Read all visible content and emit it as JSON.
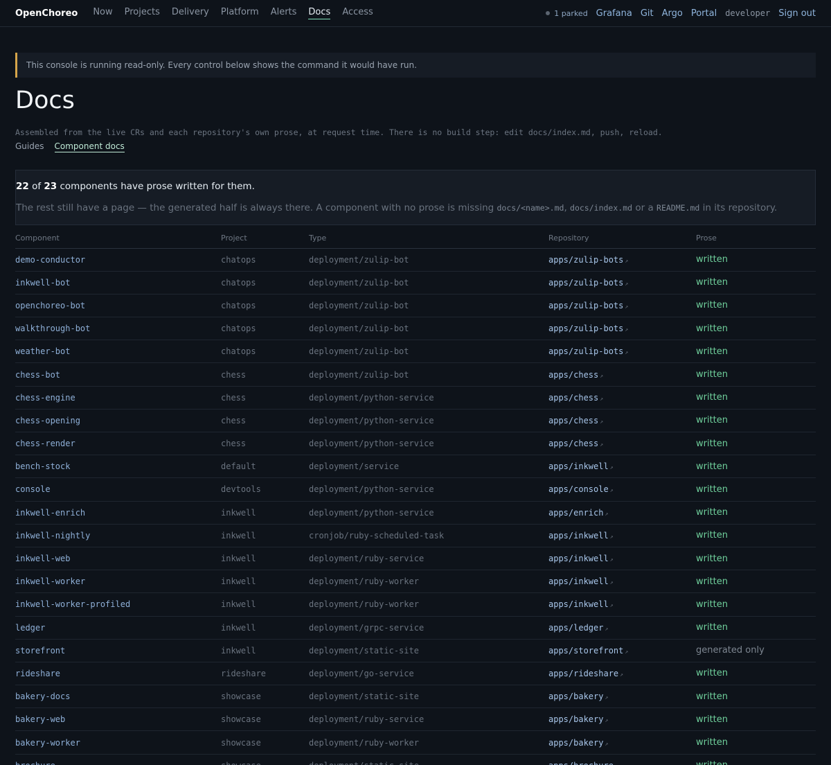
{
  "nav": {
    "brand": "OpenChoreo",
    "links": [
      "Now",
      "Projects",
      "Delivery",
      "Platform",
      "Alerts",
      "Docs",
      "Access"
    ],
    "active": "Docs",
    "parked": "1 parked",
    "right_links": [
      "Grafana",
      "Git",
      "Argo",
      "Portal"
    ],
    "user": "developer",
    "sign_out": "Sign out"
  },
  "banner": "This console is running read-only. Every control below shows the command it would have run.",
  "page": {
    "title": "Docs",
    "subtitle": "Assembled from the live CRs and each repository's own prose, at request time. There is no build step: edit docs/index.md, push, reload.",
    "tabs": [
      "Guides",
      "Component docs"
    ],
    "active_tab": "Component docs"
  },
  "summary": {
    "written_count": "22",
    "of": "of",
    "total_count": "23",
    "line_rest": "components have prose written for them.",
    "note_a": "The rest still have a page — the generated half is always there. A component with no prose is missing ",
    "code1": "docs/<name>.md",
    "sep1": ", ",
    "code2": "docs/index.md",
    "sep2": " or a ",
    "code3": "README.md",
    "note_b": " in its repository."
  },
  "table": {
    "headers": [
      "Component",
      "Project",
      "Type",
      "Repository",
      "Prose"
    ],
    "rows": [
      [
        "demo-conductor",
        "chatops",
        "deployment/zulip-bot",
        "apps/zulip-bots",
        "written"
      ],
      [
        "inkwell-bot",
        "chatops",
        "deployment/zulip-bot",
        "apps/zulip-bots",
        "written"
      ],
      [
        "openchoreo-bot",
        "chatops",
        "deployment/zulip-bot",
        "apps/zulip-bots",
        "written"
      ],
      [
        "walkthrough-bot",
        "chatops",
        "deployment/zulip-bot",
        "apps/zulip-bots",
        "written"
      ],
      [
        "weather-bot",
        "chatops",
        "deployment/zulip-bot",
        "apps/zulip-bots",
        "written"
      ],
      [
        "chess-bot",
        "chess",
        "deployment/zulip-bot",
        "apps/chess",
        "written"
      ],
      [
        "chess-engine",
        "chess",
        "deployment/python-service",
        "apps/chess",
        "written"
      ],
      [
        "chess-opening",
        "chess",
        "deployment/python-service",
        "apps/chess",
        "written"
      ],
      [
        "chess-render",
        "chess",
        "deployment/python-service",
        "apps/chess",
        "written"
      ],
      [
        "bench-stock",
        "default",
        "deployment/service",
        "apps/inkwell",
        "written"
      ],
      [
        "console",
        "devtools",
        "deployment/python-service",
        "apps/console",
        "written"
      ],
      [
        "inkwell-enrich",
        "inkwell",
        "deployment/python-service",
        "apps/enrich",
        "written"
      ],
      [
        "inkwell-nightly",
        "inkwell",
        "cronjob/ruby-scheduled-task",
        "apps/inkwell",
        "written"
      ],
      [
        "inkwell-web",
        "inkwell",
        "deployment/ruby-service",
        "apps/inkwell",
        "written"
      ],
      [
        "inkwell-worker",
        "inkwell",
        "deployment/ruby-worker",
        "apps/inkwell",
        "written"
      ],
      [
        "inkwell-worker-profiled",
        "inkwell",
        "deployment/ruby-worker",
        "apps/inkwell",
        "written"
      ],
      [
        "ledger",
        "inkwell",
        "deployment/grpc-service",
        "apps/ledger",
        "written"
      ],
      [
        "storefront",
        "inkwell",
        "deployment/static-site",
        "apps/storefront",
        "generated only"
      ],
      [
        "rideshare",
        "rideshare",
        "deployment/go-service",
        "apps/rideshare",
        "written"
      ],
      [
        "bakery-docs",
        "showcase",
        "deployment/static-site",
        "apps/bakery",
        "written"
      ],
      [
        "bakery-web",
        "showcase",
        "deployment/ruby-service",
        "apps/bakery",
        "written"
      ],
      [
        "bakery-worker",
        "showcase",
        "deployment/ruby-worker",
        "apps/bakery",
        "written"
      ],
      [
        "brochure",
        "showcase",
        "deployment/static-site",
        "apps/brochure",
        "written"
      ]
    ]
  },
  "colors": {
    "background": "#0e131a",
    "banner_accent": "#d6a54a",
    "written": "#6fcf9b",
    "link": "#8fb4dc"
  },
  "icons": {
    "external_link": "external-link-icon",
    "status_dot": "status-dot-icon"
  }
}
